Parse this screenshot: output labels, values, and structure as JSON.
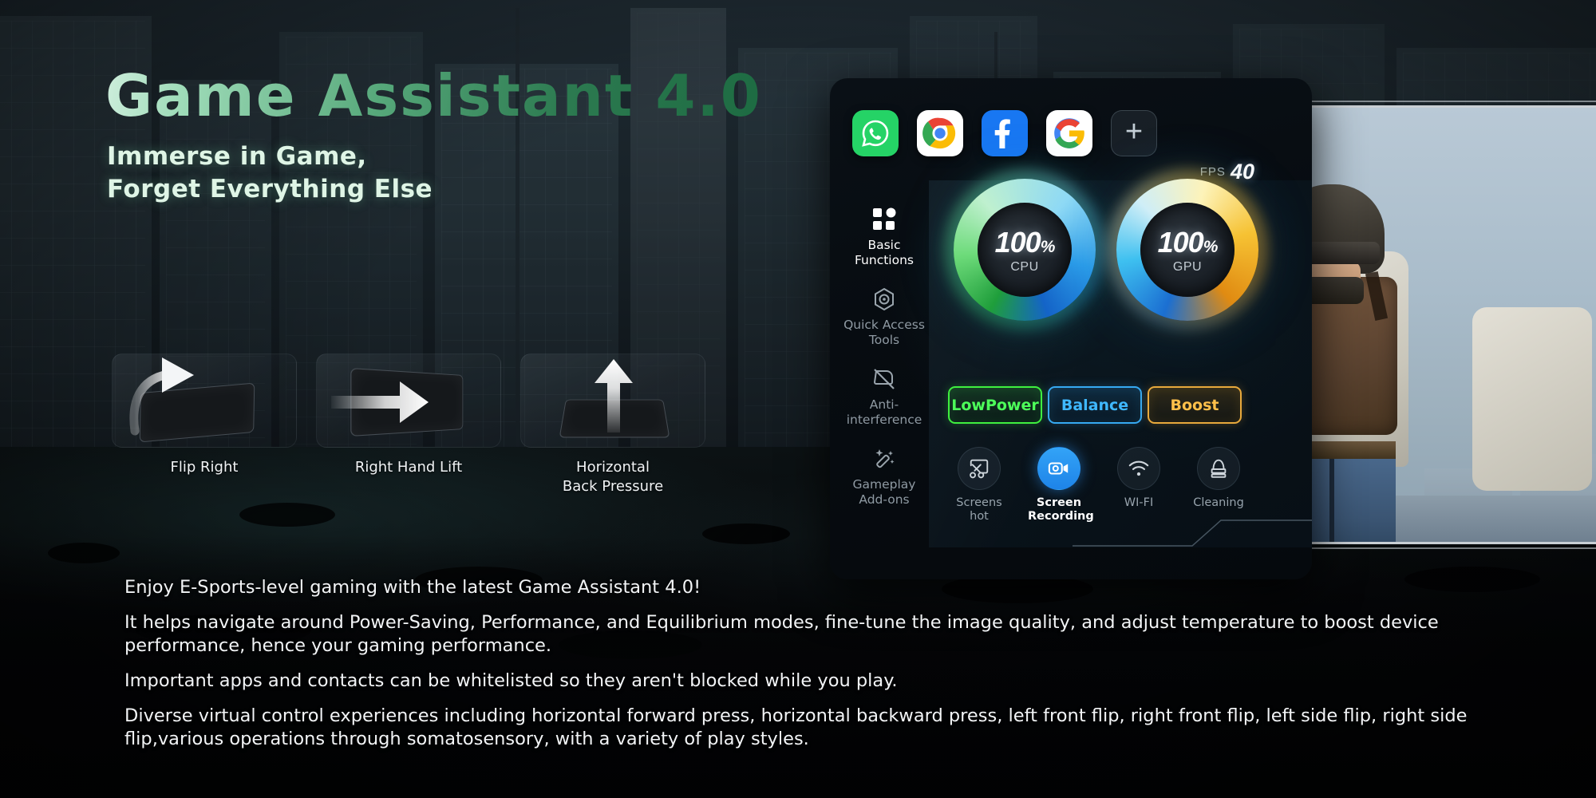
{
  "hero": {
    "title": "Game Assistant 4.0",
    "subtitle_line1": "Immerse in Game,",
    "subtitle_line2": "Forget Everything Else",
    "title_color_start": "#cfeedd",
    "title_color_end": "#1d6b42"
  },
  "gestures": [
    {
      "label": "Flip Right",
      "icon": "curved-arrow-right-icon"
    },
    {
      "label": "Right Hand Lift",
      "icon": "arrow-right-icon"
    },
    {
      "label": "Horizontal\nBack Pressure",
      "label_line1": "Horizontal",
      "label_line2": "Back Pressure",
      "icon": "arrow-up-icon"
    }
  ],
  "panel": {
    "apps": [
      {
        "name": "WhatsApp",
        "icon": "whatsapp-icon"
      },
      {
        "name": "Chrome",
        "icon": "chrome-icon"
      },
      {
        "name": "Facebook",
        "icon": "facebook-icon"
      },
      {
        "name": "Google",
        "icon": "google-icon"
      },
      {
        "name": "Add app",
        "icon": "plus-icon",
        "label": "+"
      }
    ],
    "sidebar": [
      {
        "label_line1": "Basic",
        "label_line2": "Functions",
        "icon": "four-squares-icon",
        "active": true
      },
      {
        "label_line1": "Quick Access",
        "label_line2": "Tools",
        "icon": "hexagon-dot-icon",
        "active": false
      },
      {
        "label_line1": "Anti-",
        "label_line2": "interference",
        "icon": "no-notification-icon",
        "active": false
      },
      {
        "label_line1": "Gameplay",
        "label_line2": "Add-ons",
        "icon": "magic-wand-icon",
        "active": false
      }
    ],
    "fps": {
      "label": "FPS",
      "value": "40"
    },
    "gauges": [
      {
        "name": "CPU",
        "value": "100",
        "unit": "%",
        "color_start": "#1f9e3b",
        "color_end": "#1464c8"
      },
      {
        "name": "GPU",
        "value": "100",
        "unit": "%",
        "color_start": "#1b6fd2",
        "color_end": "#e08b12"
      }
    ],
    "modes": [
      {
        "label": "LowPower",
        "color": "#4dff5a"
      },
      {
        "label": "Balance",
        "color": "#3fb8ff"
      },
      {
        "label": "Boost",
        "color": "#ffc04a"
      }
    ],
    "tools": [
      {
        "label_line1": "Screens",
        "label_line2": "hot",
        "icon": "screenshot-scissors-icon",
        "active": false
      },
      {
        "label_line1": "Screen",
        "label_line2": "Recording",
        "icon": "video-camera-icon",
        "active": true
      },
      {
        "label_line1": "WI-FI",
        "label_line2": "",
        "icon": "wifi-icon",
        "active": false
      },
      {
        "label_line1": "Cleaning",
        "label_line2": "",
        "icon": "brush-icon",
        "active": false
      }
    ]
  },
  "copy": {
    "p1": "Enjoy E-Sports-level gaming with the latest Game Assistant 4.0!",
    "p2": "It helps navigate around Power-Saving, Performance, and Equilibrium modes, fine-tune the image quality, and adjust temperature to boost device performance, hence your gaming performance.",
    "p3": "Important apps and contacts can be whitelisted so they aren't blocked while you play.",
    "p4": "Diverse virtual control experiences including horizontal forward press, horizontal backward press, left front flip, right front flip, left side flip, right side flip,various operations through somatosensory, with a variety of play styles."
  }
}
